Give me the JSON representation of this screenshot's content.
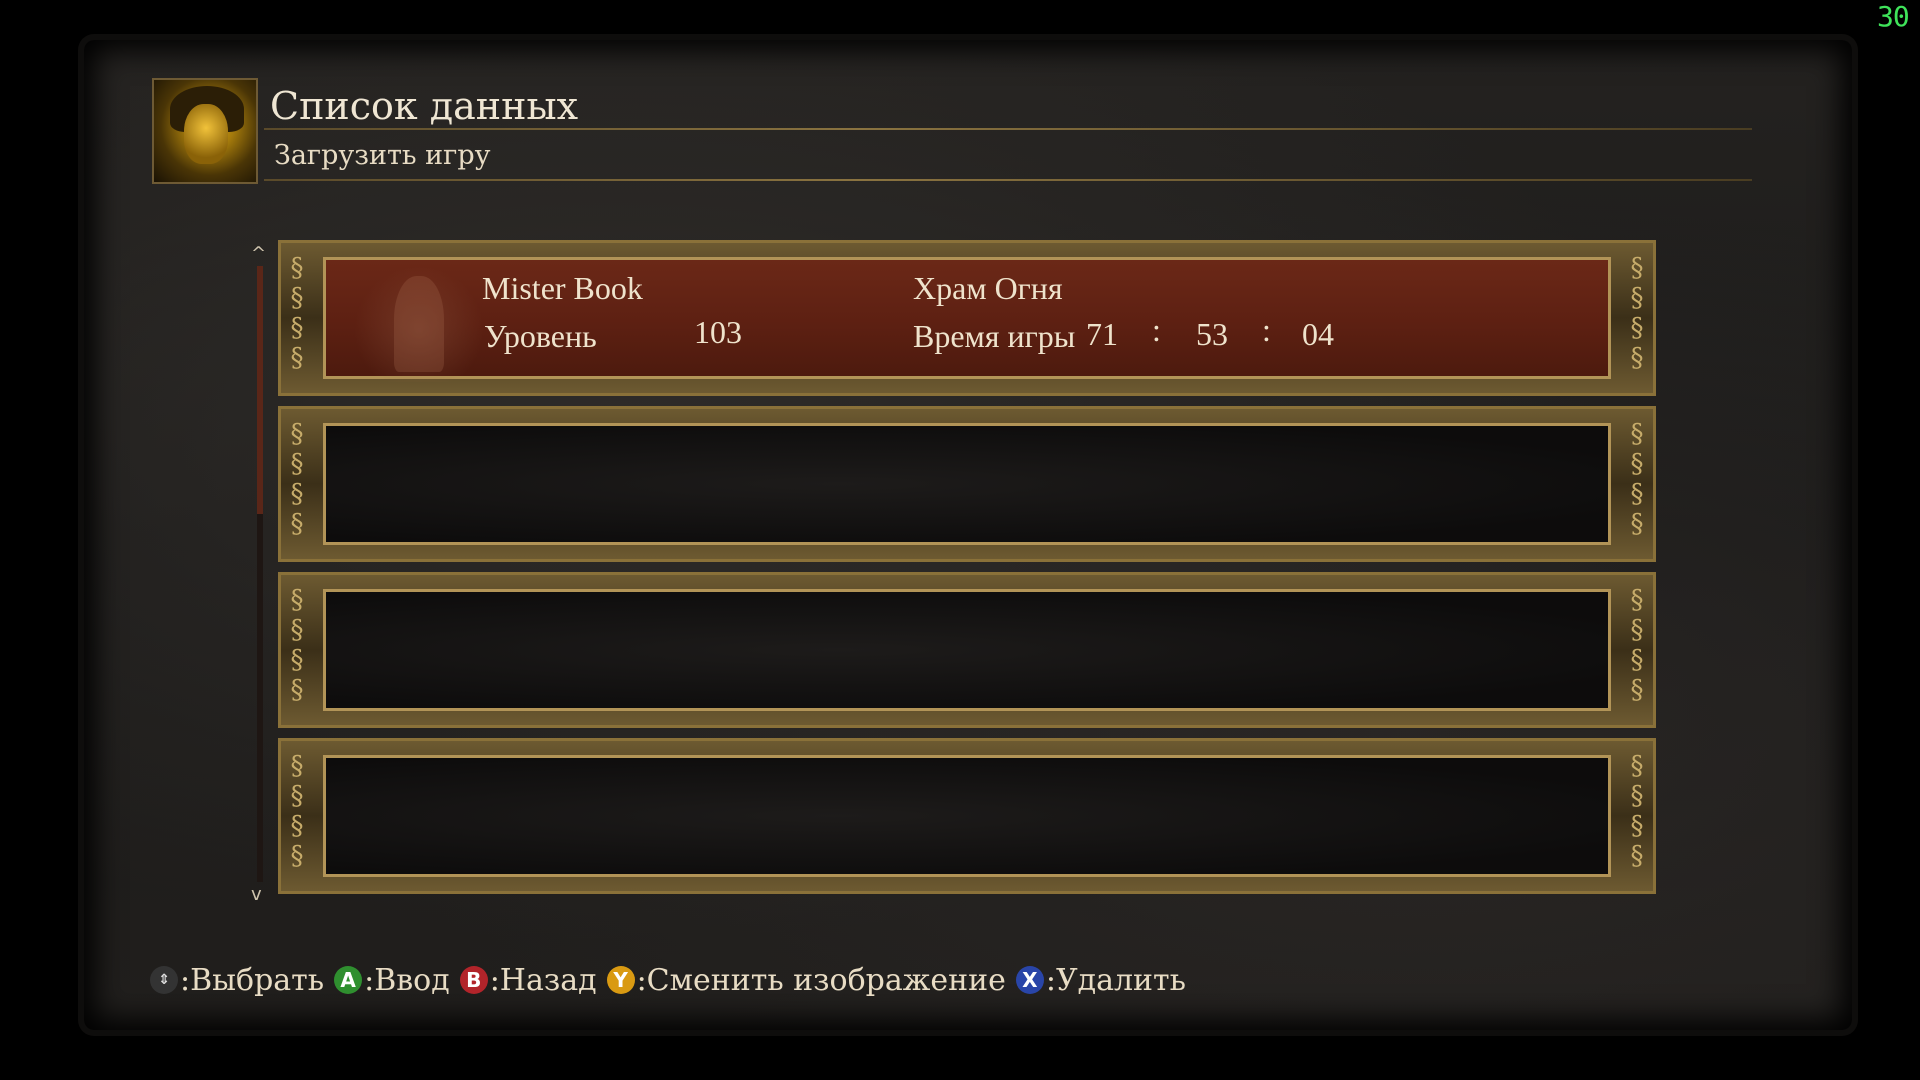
{
  "fps_counter": "30",
  "header": {
    "title": "Список данных",
    "subtitle": "Загрузить игру"
  },
  "scroll": {
    "up_icon": "scroll-up-arrow",
    "down_icon": "scroll-down-arrow"
  },
  "slots": [
    {
      "selected": true,
      "name": "Mister Book",
      "location": "Храм Огня",
      "level_label": "Уровень",
      "level_value": "103",
      "playtime_label": "Время игры",
      "playtime_h": "71",
      "playtime_sep1": ":",
      "playtime_m": "53",
      "playtime_sep2": ":",
      "playtime_s": "04"
    },
    {
      "selected": false
    },
    {
      "selected": false
    },
    {
      "selected": false
    }
  ],
  "hints": [
    {
      "icon": "dpad-icon",
      "glyph": "⇕",
      "label": ":Выбрать"
    },
    {
      "icon": "a-button-icon",
      "glyph": "A",
      "label": ":Ввод"
    },
    {
      "icon": "b-button-icon",
      "glyph": "B",
      "label": ":Назад"
    },
    {
      "icon": "y-button-icon",
      "glyph": "Y",
      "label": ":Сменить изображение"
    },
    {
      "icon": "x-button-icon",
      "glyph": "X",
      "label": ":Удалить"
    }
  ],
  "colors": {
    "selected_slot": "#5d2012",
    "frame_gold": "#b29457",
    "fps_green": "#3fe35a"
  }
}
